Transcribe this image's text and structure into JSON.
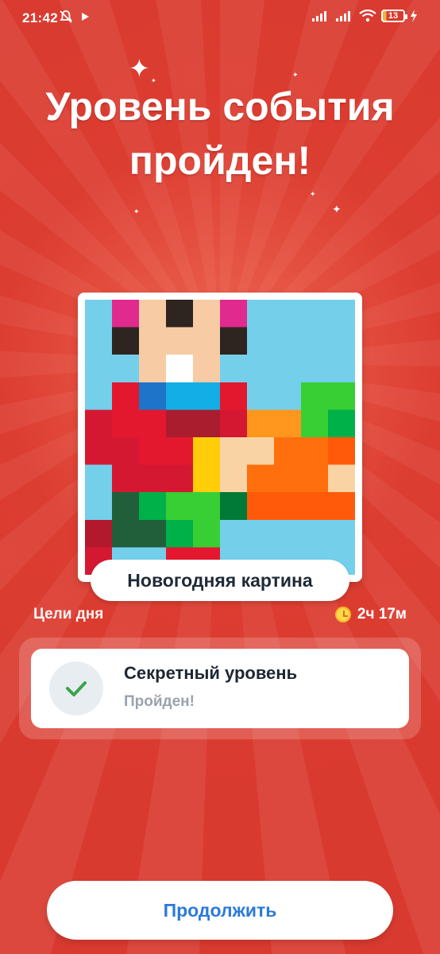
{
  "status_bar": {
    "time": "21:42",
    "battery": "13",
    "icons": [
      "bell-off-icon",
      "play-icon",
      "signal-icon",
      "signal-icon",
      "wifi-icon",
      "battery-icon",
      "charging-icon"
    ]
  },
  "event": {
    "title_line1": "Уровень события",
    "title_line2": "пройден!"
  },
  "picture": {
    "label": "Новогодняя картина"
  },
  "goals": {
    "title": "Цели дня",
    "timer": "2ч 17м",
    "items": [
      {
        "title": "Секретный уровень",
        "status": "Пройден!",
        "completed": true
      }
    ]
  },
  "actions": {
    "continue_label": "Продолжить"
  },
  "colors": {
    "background": "#d93a2f",
    "accent": "#2c7ad8",
    "check": "#3aa44a"
  }
}
